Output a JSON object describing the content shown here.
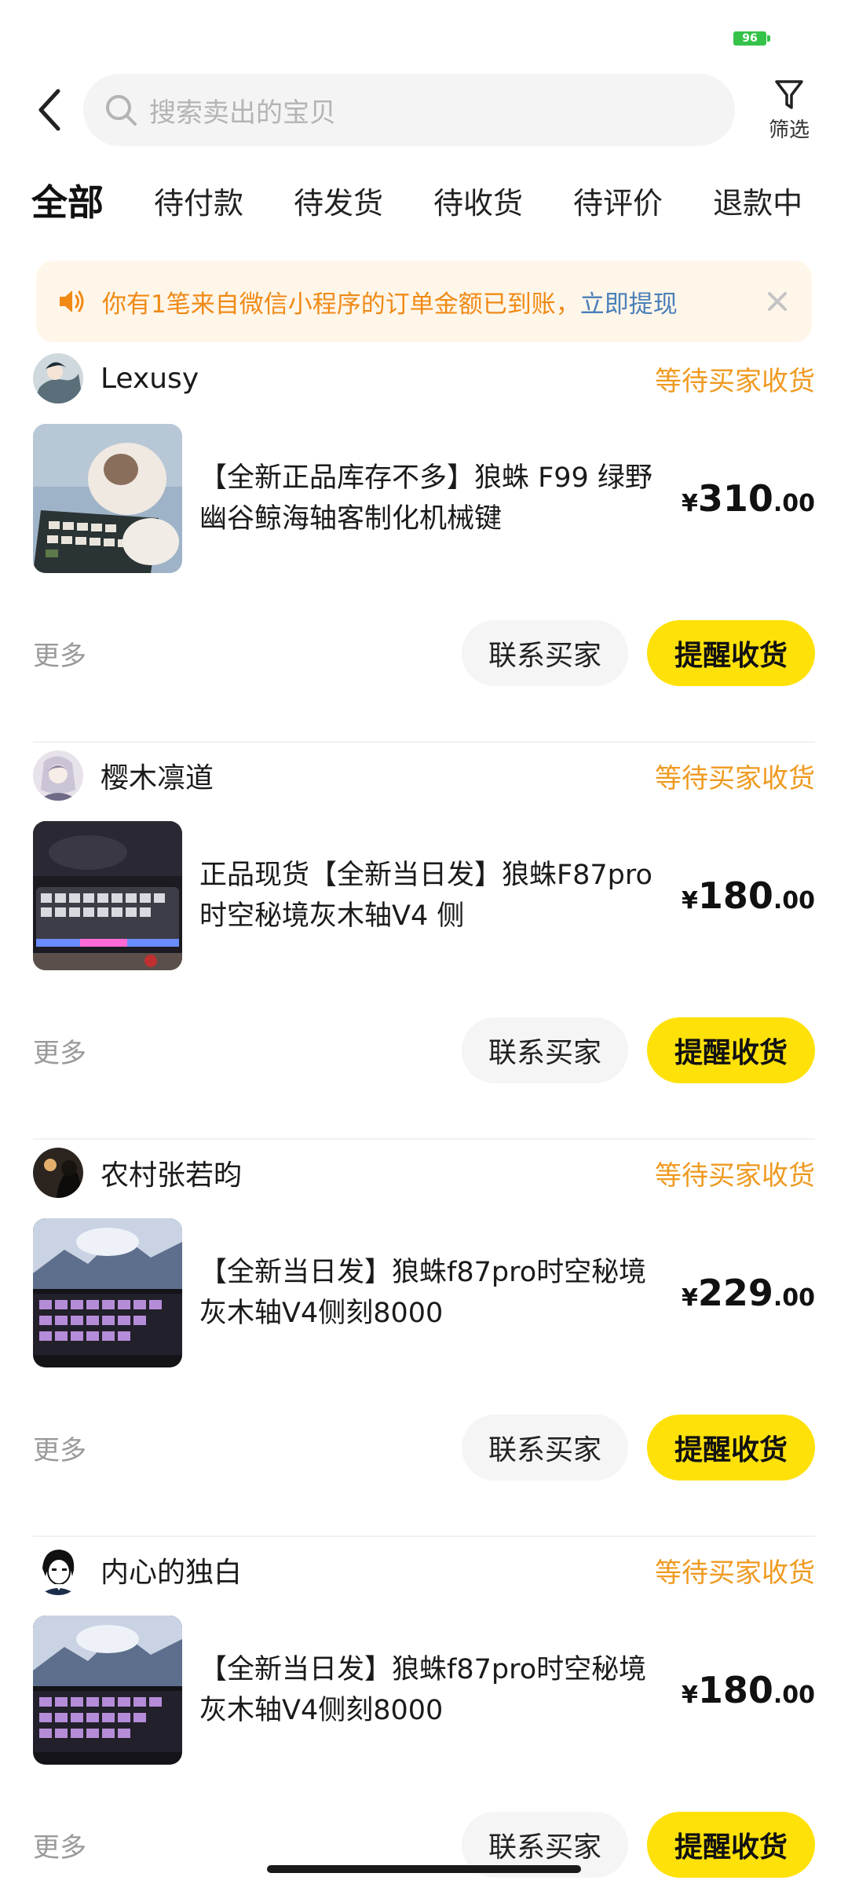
{
  "status_bar": {
    "battery": "96"
  },
  "header": {
    "search_placeholder": "搜索卖出的宝贝",
    "filter_label": "筛选"
  },
  "tabs": [
    "全部",
    "待付款",
    "待发货",
    "待收货",
    "待评价",
    "退款中"
  ],
  "active_tab": "全部",
  "notice": {
    "text": "你有1笔来自微信小程序的订单金额已到账，",
    "link": "立即提现"
  },
  "orders": [
    {
      "buyer": "Lexusy",
      "status": "等待买家收货",
      "title": "【全新正品库存不多】狼蛛 F99 绿野幽谷鲸海轴客制化机械键",
      "price_symbol": "¥",
      "price_int": "310",
      "price_dec": ".00",
      "more": "更多",
      "contact_label": "联系买家",
      "remind_label": "提醒收货"
    },
    {
      "buyer": "樱木凛道",
      "status": "等待买家收货",
      "title": "正品现货【全新当日发】狼蛛F87pro时空秘境灰木轴V4 侧",
      "price_symbol": "¥",
      "price_int": "180",
      "price_dec": ".00",
      "more": "更多",
      "contact_label": "联系买家",
      "remind_label": "提醒收货"
    },
    {
      "buyer": "农村张若昀",
      "status": "等待买家收货",
      "title": "【全新当日发】狼蛛f87pro时空秘境灰木轴V4侧刻8000",
      "price_symbol": "¥",
      "price_int": "229",
      "price_dec": ".00",
      "more": "更多",
      "contact_label": "联系买家",
      "remind_label": "提醒收货"
    },
    {
      "buyer": "内心的独白",
      "status": "等待买家收货",
      "title": "【全新当日发】狼蛛f87pro时空秘境灰木轴V4侧刻8000",
      "price_symbol": "¥",
      "price_int": "180",
      "price_dec": ".00",
      "more": "更多",
      "contact_label": "联系买家",
      "remind_label": "提醒收货"
    }
  ],
  "colors": {
    "accent_yellow": "#ffe10a",
    "status_orange": "#ef9a20",
    "notice_bg": "#fff6ea",
    "link_blue": "#4a7fb8"
  }
}
